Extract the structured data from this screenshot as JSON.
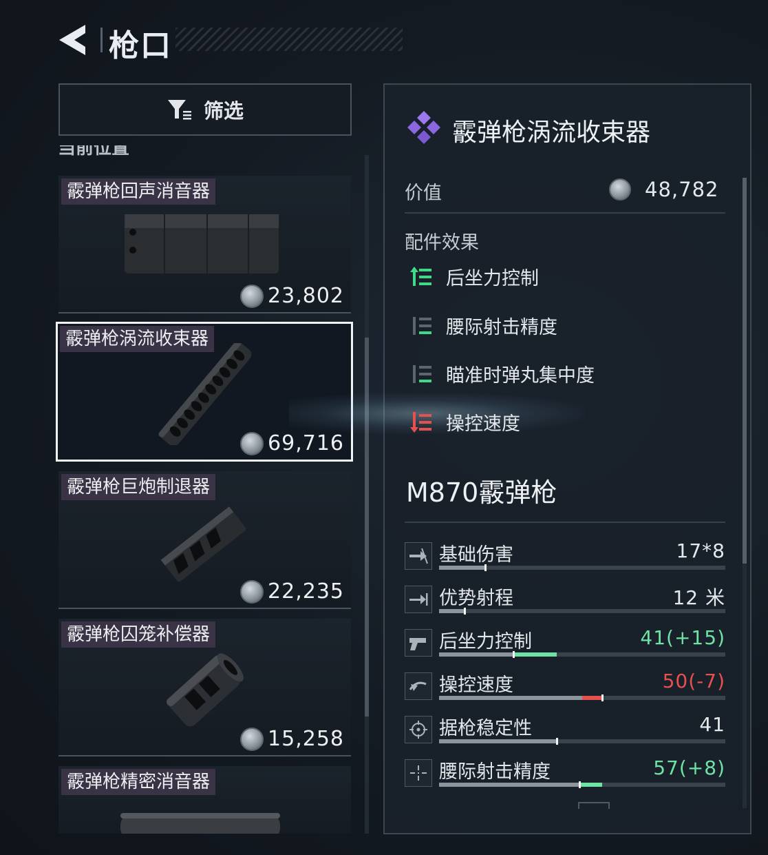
{
  "header": {
    "title": "枪口"
  },
  "filter": {
    "label": "筛选"
  },
  "list": {
    "section_label": "当前位置",
    "items": [
      {
        "name": "霰弹枪回声消音器",
        "price": "23,802",
        "selected": false
      },
      {
        "name": "霰弹枪涡流收束器",
        "price": "69,716",
        "selected": true
      },
      {
        "name": "霰弹枪巨炮制退器",
        "price": "22,235",
        "selected": false
      },
      {
        "name": "霰弹枪囚笼补偿器",
        "price": "15,258",
        "selected": false
      },
      {
        "name": "霰弹枪精密消音器",
        "price": "",
        "selected": false
      }
    ]
  },
  "detail": {
    "title": "霰弹枪涡流收束器",
    "value_label": "价值",
    "value": "48,782",
    "effects_heading": "配件效果",
    "effects": [
      {
        "label": "后坐力控制",
        "icon": "stat-up-icon",
        "state": "up"
      },
      {
        "label": "腰际射击精度",
        "icon": "stat-neutral-icon",
        "state": "neutral"
      },
      {
        "label": "瞄准时弹丸集中度",
        "icon": "stat-neutral-icon",
        "state": "neutral"
      },
      {
        "label": "操控速度",
        "icon": "stat-down-icon",
        "state": "down"
      }
    ],
    "weapon_name": "M870霰弹枪",
    "stats": [
      {
        "label": "基础伤害",
        "value": "17*8",
        "icon": "damage-icon",
        "tone": "normal",
        "base": 0.16,
        "delta": 0
      },
      {
        "label": "优势射程",
        "value": "12 米",
        "icon": "range-icon",
        "tone": "normal",
        "base": 0.09,
        "delta": 0
      },
      {
        "label": "后坐力控制",
        "value": "41(+15)",
        "icon": "recoil-icon",
        "tone": "pos",
        "base": 0.26,
        "delta": 0.15
      },
      {
        "label": "操控速度",
        "value": "50(-7)",
        "icon": "handling-icon",
        "tone": "neg",
        "base": 0.57,
        "delta": -0.07
      },
      {
        "label": "据枪稳定性",
        "value": "41",
        "icon": "stability-icon",
        "tone": "normal",
        "base": 0.41,
        "delta": 0
      },
      {
        "label": "腰际射击精度",
        "value": "57(+8)",
        "icon": "hipfire-icon",
        "tone": "pos",
        "base": 0.49,
        "delta": 0.08
      }
    ]
  },
  "colors": {
    "positive": "#6fe3a5",
    "negative": "#e6504f",
    "rarity_purple": "#8f6ae6",
    "selection": "#f2f4f6"
  }
}
